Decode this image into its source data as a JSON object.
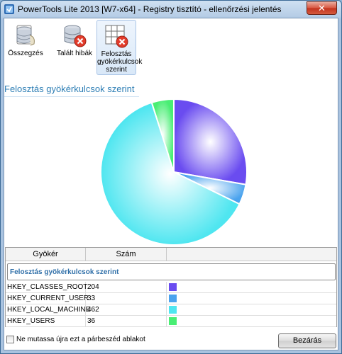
{
  "window": {
    "title": "PowerTools Lite 2013 [W7-x64] - Registry tisztító - ellenőrzési jelentés",
    "close_glyph": "✕"
  },
  "toolbar": {
    "items": [
      {
        "label": "Összegzés",
        "icon": "registry-stack-icon"
      },
      {
        "label": "Talált hibák",
        "icon": "registry-error-icon"
      },
      {
        "label": "Felosztás gyökérkulcsok szerint",
        "label_lines": [
          "Felosztás",
          "gyökérkulcsok",
          "szerint"
        ],
        "icon": "grid-error-icon",
        "active": true
      }
    ]
  },
  "section": {
    "title": "Felosztás gyökérkulcsok szerint"
  },
  "chart_data": {
    "type": "pie",
    "categories": [
      "HKEY_CLASSES_ROOT",
      "HKEY_CURRENT_USER",
      "HKEY_LOCAL_MACHINE",
      "HKEY_USERS"
    ],
    "values": [
      204,
      33,
      462,
      36
    ],
    "colors": [
      "#6a4cf0",
      "#4aa3ee",
      "#4fe6f0",
      "#49ee74"
    ]
  },
  "table": {
    "headers": [
      "Gyökér",
      "Szám",
      ""
    ],
    "group_label": "Felosztás gyökérkulcsok szerint",
    "rows": [
      {
        "root": "HKEY_CLASSES_ROOT",
        "count": "204",
        "color": "#6a4cf0"
      },
      {
        "root": "HKEY_CURRENT_USER",
        "count": "33",
        "color": "#4aa3ee"
      },
      {
        "root": "HKEY_LOCAL_MACHINE",
        "count": "462",
        "color": "#4fe6f0"
      },
      {
        "root": "HKEY_USERS",
        "count": "36",
        "color": "#49ee74"
      }
    ]
  },
  "footer": {
    "checkbox_label": "Ne mutassa újra ezt a párbeszéd ablakot",
    "checkbox_checked": false,
    "close_label": "Bezárás"
  }
}
